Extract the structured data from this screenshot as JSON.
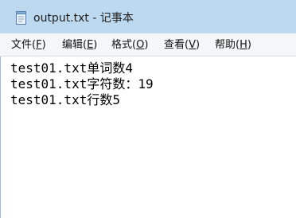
{
  "window": {
    "title": "output.txt - 记事本",
    "icon": "notepad-icon"
  },
  "menu": {
    "file": {
      "label": "文件(",
      "accel": "F",
      "close": ")"
    },
    "edit": {
      "label": "编辑(",
      "accel": "E",
      "close": ")"
    },
    "format": {
      "label": "格式(",
      "accel": "O",
      "close": ")"
    },
    "view": {
      "label": "查看(",
      "accel": "V",
      "close": ")"
    },
    "help": {
      "label": "帮助(",
      "accel": "H",
      "close": ")"
    }
  },
  "document": {
    "lines": [
      "test01.txt单词数4",
      "test01.txt字符数：19",
      "test01.txt行数5"
    ]
  },
  "colors": {
    "titlebar": "#bcd9f0",
    "menubar": "#f5f6f7",
    "text": "#000000"
  }
}
